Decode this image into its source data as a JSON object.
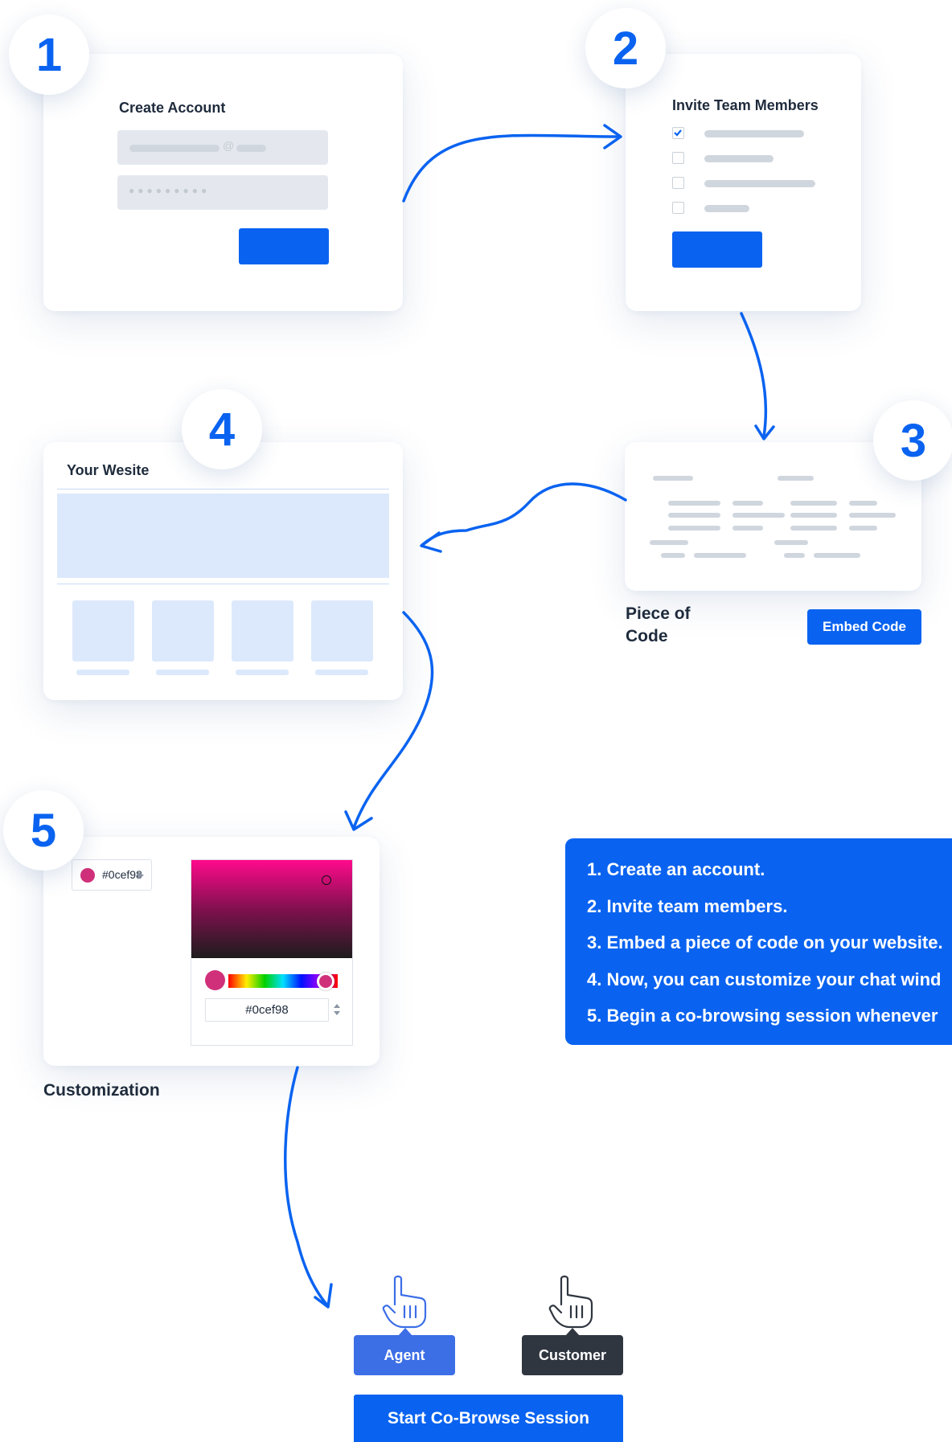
{
  "step_badges": [
    "1",
    "2",
    "3",
    "4",
    "5"
  ],
  "card1": {
    "title": "Create Account",
    "at_symbol": "@",
    "password_mask": "●●●●●●●●●"
  },
  "card2": {
    "title": "Invite Team Members",
    "checked": [
      true,
      false,
      false,
      false
    ]
  },
  "card3": {
    "caption": "Piece of Code",
    "embed_button": "Embed Code"
  },
  "card4": {
    "title": "Your Wesite"
  },
  "card5": {
    "caption": "Customization",
    "color_value": "#0cef98",
    "hex_input": "#0cef98",
    "swatch_color": "#d0307a"
  },
  "steps": [
    "1. Create an account.",
    "2. Invite team members.",
    "3. Embed a piece of code on your website.",
    "4. Now, you can customize your chat wind",
    "5. Begin a co-browsing session whenever"
  ],
  "roles": {
    "agent": "Agent",
    "customer": "Customer"
  },
  "start_button": "Start Co-Browse Session",
  "colors": {
    "accent": "#0a63f0",
    "text": "#1e2b3c",
    "customer_dark": "#2f3640",
    "agent_blue": "#3c6ee6"
  },
  "icons": {
    "check": "check-icon",
    "pointer": "pointer-hand-icon",
    "dropdown": "caret-right-icon"
  }
}
